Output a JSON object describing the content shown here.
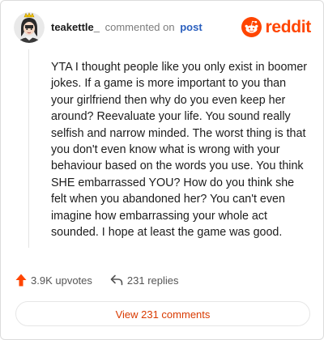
{
  "comment": {
    "username": "teakettle_",
    "action_text": "commented on",
    "post_link": "post",
    "body": "YTA I thought people like you only exist in boomer jokes. If a game is more important to you than your girlfriend then why do you even keep her around? Reevaluate your life. You sound really selfish and narrow minded. The worst thing is that you don't even know what is wrong with your behaviour based on the words you use. You think SHE embarrassed YOU? How do you think she felt when you abandoned her? You can't even imagine how embarrassing your whole act sounded. I hope at least the game was good."
  },
  "brand": {
    "wordmark": "reddit",
    "icon": "reddit-alien-icon",
    "color": "#ff4500"
  },
  "stats": {
    "upvotes": "3.9K upvotes",
    "replies": "231 replies",
    "upvote_icon": "upvote-arrow-icon",
    "reply_icon": "reply-arrow-icon",
    "upvote_color": "#ff4500"
  },
  "actions": {
    "view_comments": "View 231 comments"
  },
  "colors": {
    "link": "#2a5fbe",
    "view_button_text": "#d93a00"
  }
}
